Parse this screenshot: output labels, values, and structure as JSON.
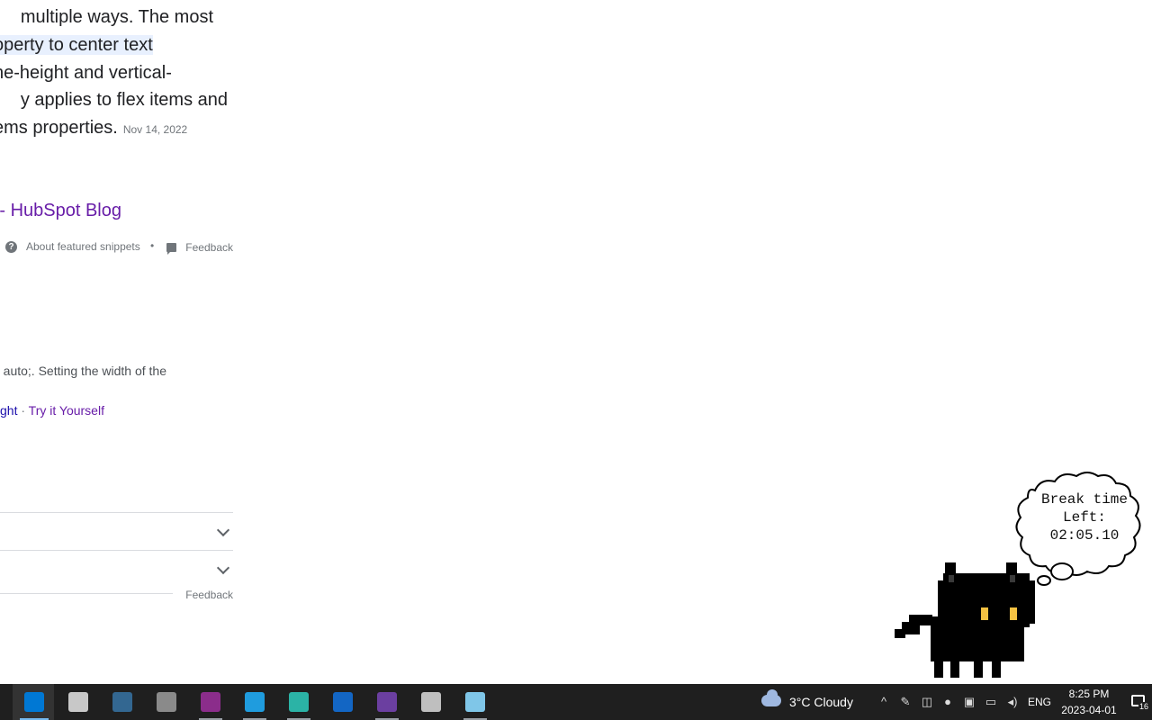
{
  "snippet": {
    "lines": [
      "multiple ways. The most",
      "operty to center text",
      "ne-height and vertical-",
      "y applies to flex items and",
      "ems properties."
    ],
    "date": "Nov 14, 2022",
    "source_link": "- HubSpot Blog",
    "about_label": "About featured snippets",
    "dot": "•",
    "feedback_label": "Feedback"
  },
  "result2": {
    "description": "auto;. Setting the width of the",
    "links": [
      "ght",
      "Try it Yourself"
    ],
    "separator": "·"
  },
  "people_also_ask": {
    "feedback_label": "Feedback"
  },
  "pet": {
    "bubble_text": "Break time\nLeft:\n02:05.10"
  },
  "taskbar": {
    "apps": [
      {
        "name": "vscode",
        "color": "#0078d4"
      },
      {
        "name": "database",
        "color": "#c8c8c8"
      },
      {
        "name": "postgres",
        "color": "#336791"
      },
      {
        "name": "tool",
        "color": "#8a8a8a"
      },
      {
        "name": "winrar",
        "color": "#8b2d8b"
      },
      {
        "name": "edge",
        "color": "#1f9cde"
      },
      {
        "name": "edge-dev",
        "color": "#2bb3a6"
      },
      {
        "name": "photos",
        "color": "#1366c4"
      },
      {
        "name": "visual-studio-installer",
        "color": "#6b3fa0"
      },
      {
        "name": "music",
        "color": "#bfbfbf"
      },
      {
        "name": "notepad",
        "color": "#7fc6e8"
      }
    ],
    "weather": "3°C  Cloudy",
    "language": "ENG",
    "time": "8:25 PM",
    "date": "2023-04-01",
    "notifications": "16"
  }
}
